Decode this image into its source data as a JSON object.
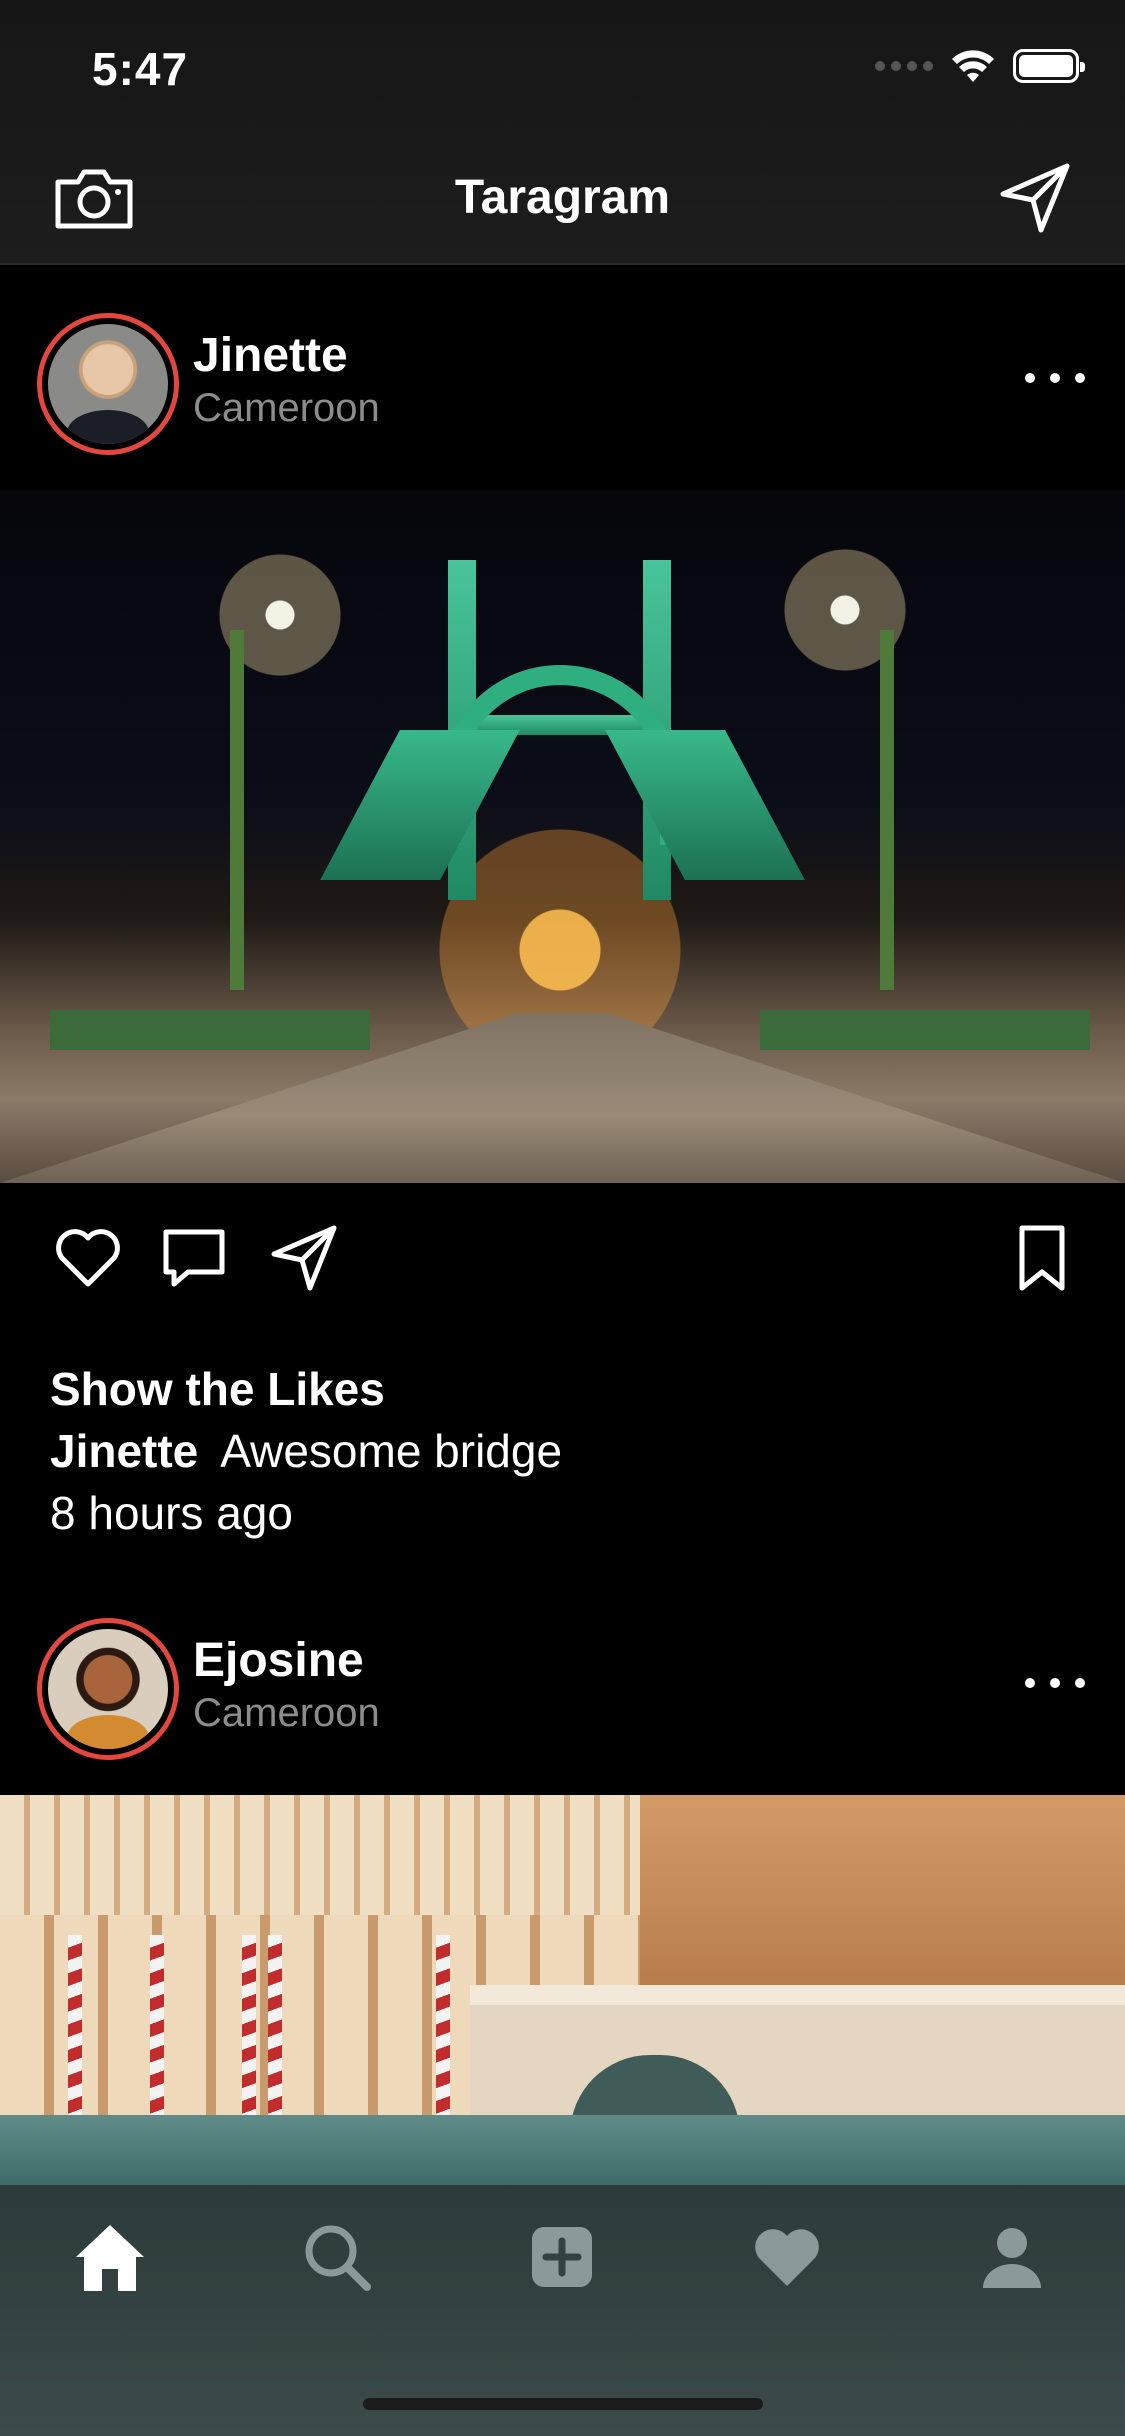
{
  "status_bar": {
    "time": "5:47"
  },
  "nav": {
    "title": "Taragram",
    "left_icon": "camera-icon",
    "right_icon": "paper-plane-icon"
  },
  "posts": [
    {
      "user": "Jinette",
      "location": "Cameroon",
      "photo": "Illuminated green bridge at night"
    },
    {
      "user": "Ejosine",
      "location": "Cameroon",
      "photo": "Venetian palace with gondola and bridge"
    }
  ],
  "post_details": {
    "likes_label": "Show the Likes",
    "caption_user": "Jinette",
    "caption_text": "Awesome bridge",
    "timestamp": "8 hours ago"
  },
  "actions": [
    "heart-icon",
    "comment-icon",
    "share-icon",
    "bookmark-icon"
  ],
  "tab_bar": {
    "items": [
      "home-icon",
      "search-icon",
      "add-icon",
      "heart-icon",
      "profile-icon"
    ],
    "active": "home-icon"
  },
  "colors": {
    "avatar_ring": "#e3483e",
    "secondary_text": "#8c8c8c",
    "tab_inactive": "#8a9a98"
  }
}
